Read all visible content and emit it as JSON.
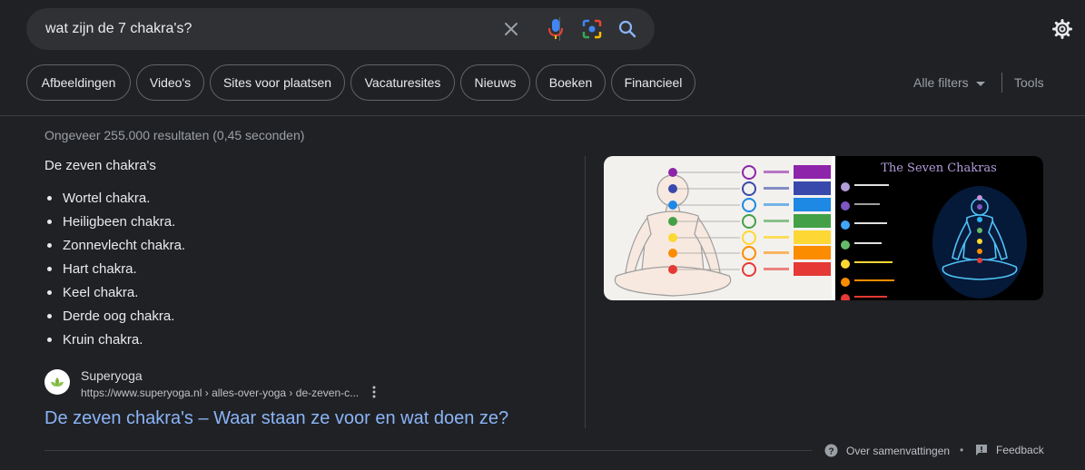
{
  "search": {
    "query": "wat zijn de 7 chakra's?"
  },
  "chips": [
    {
      "label": "Afbeeldingen"
    },
    {
      "label": "Video's"
    },
    {
      "label": "Sites voor plaatsen"
    },
    {
      "label": "Vacaturesites"
    },
    {
      "label": "Nieuws"
    },
    {
      "label": "Boeken"
    },
    {
      "label": "Financieel"
    }
  ],
  "filters": {
    "all_filters": "Alle filters",
    "tools": "Tools"
  },
  "results_stats": "Ongeveer 255.000 resultaten (0,45 seconden)",
  "snippet": {
    "title": "De zeven chakra's",
    "items": [
      "Wortel chakra.",
      "Heiligbeen chakra.",
      "Zonnevlecht chakra.",
      "Hart chakra.",
      "Keel chakra.",
      "Derde oog chakra.",
      "Kruin chakra."
    ]
  },
  "images": {
    "right_title": "The Seven Chakras"
  },
  "source": {
    "name": "Superyoga",
    "url": "https://www.superyoga.nl › alles-over-yoga › de-zeven-c...",
    "link_title": "De zeven chakra's – Waar staan ze voor en wat doen ze?"
  },
  "footer": {
    "about": "Over samenvattingen",
    "feedback": "Feedback",
    "separator": "•"
  },
  "colors": {
    "background": "#202124",
    "surface": "#303134",
    "link": "#8ab4f8",
    "text": "#e8eaed",
    "muted": "#9aa0a6",
    "chakra": [
      "#8e24aa",
      "#3949ab",
      "#1e88e5",
      "#43a047",
      "#fdd835",
      "#fb8c00",
      "#e53935"
    ]
  }
}
